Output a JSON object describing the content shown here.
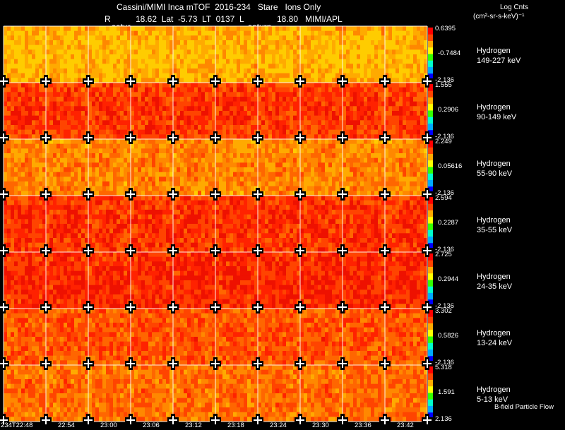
{
  "header": {
    "line1": "Cassini/MIMI Inca mTOF  2016-234   Stare   Ions Only",
    "line2_r": "R",
    "line2_main": "18.62  Lat  -5.73  LT  0137  L",
    "line2_l": "18.80",
    "line2_apl": "MIMI/APL",
    "saturn_label_1": "satur",
    "saturn_label_2": "saturn",
    "units_title": "Log Cnts",
    "units": "(cm²-sr-s-keV)⁻¹"
  },
  "chart_data": {
    "type": "heatmap",
    "columns": 10,
    "x_tick_labels": [
      "234T22:48",
      "22:54",
      "23:00",
      "23:06",
      "23:12",
      "23:18",
      "23:24",
      "23:30",
      "23:36",
      "23:42"
    ],
    "panels": [
      {
        "species": "Hydrogen",
        "energy": "149-227 keV",
        "max": "0.6395",
        "mid": "-0.7484",
        "min": "-2.136"
      },
      {
        "species": "Hydrogen",
        "energy": "90-149 keV",
        "max": "1.555",
        "mid": "0.2906",
        "min": "-2.136"
      },
      {
        "species": "Hydrogen",
        "energy": "55-90 keV",
        "max": "2.249",
        "mid": "0.05616",
        "min": "-2.136"
      },
      {
        "species": "Hydrogen",
        "energy": "35-55 keV",
        "max": "2.594",
        "mid": "0.2287",
        "min": "-2.136"
      },
      {
        "species": "Hydrogen",
        "energy": "24-35 keV",
        "max": "2.725",
        "mid": "0.2944",
        "min": "-2.136"
      },
      {
        "species": "Hydrogen",
        "energy": "13-24 keV",
        "max": "3.302",
        "mid": "0.5826",
        "min": "-2.136"
      },
      {
        "species": "Hydrogen",
        "energy": "5-13 keV",
        "max": "5.318",
        "mid": "1.591",
        "min": "2.136"
      }
    ],
    "colorscale": [
      "#0000ff",
      "#00aaff",
      "#00ffcc",
      "#33ff00",
      "#ffff00",
      "#ffaa00",
      "#ff4400",
      "#ff0000"
    ],
    "footer_note": "B-field Particle Flow"
  }
}
